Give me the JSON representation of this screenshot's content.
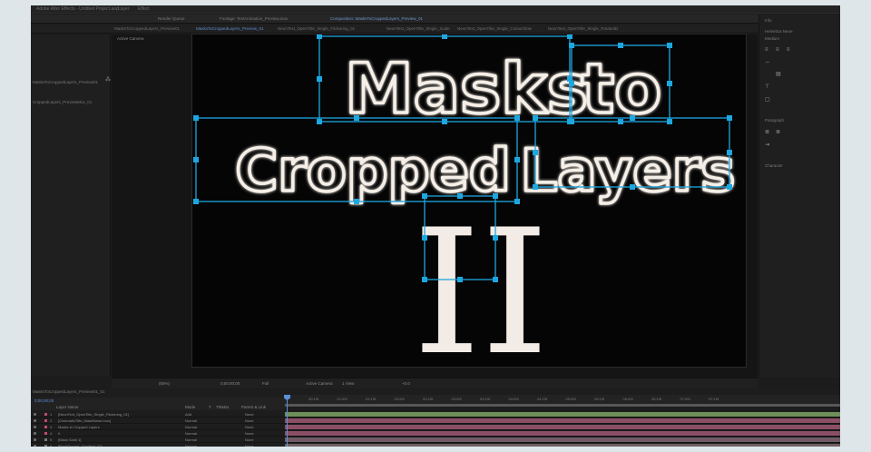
{
  "app": {
    "title": "Adobe After Effects - Untitled Project.aep",
    "menu_items": [
      "Layer",
      "Effect",
      "Animation",
      "View",
      "Window",
      "Help"
    ],
    "panel_tabs": [
      "Render Queue",
      "Footage: TextAnimation_Preview.mov",
      "Composition: MasksToCroppedLayers_Preview_01"
    ]
  },
  "comp_tabs": [
    {
      "label": "MasksToCroppedLayers_Preview01",
      "selected": false
    },
    {
      "label": "MasksToCroppedLayers_Preview_01",
      "selected": true
    },
    {
      "label": "NeonText_OpenTitle_Single_Flickering_01",
      "selected": false
    },
    {
      "label": "NeonText_OpenTitle_Single_Scale",
      "selected": false
    },
    {
      "label": "NeonText_OpenTitle_Single_ColourGlow",
      "selected": false
    },
    {
      "label": "NeonText_OpenTitle_Single_Rotate3D",
      "selected": false
    }
  ],
  "project_panel": {
    "items": [
      "MasksToCroppedLayers_Preview01",
      "CroppedLayers_PreviewMov_01"
    ]
  },
  "viewer": {
    "caption": "Active Camera",
    "lines": [
      "Masks to",
      "Cropped Layers",
      "II"
    ],
    "accent_color": "#1da7e0",
    "text_color": "#f5efe8",
    "numeral_color": "#f3ece6"
  },
  "viewer_bar": {
    "zoom": "(50%)",
    "time": "0;00;00;00",
    "resolution": "Full",
    "camera": "Active Camera",
    "view": "1 View",
    "exposure": "+0.0"
  },
  "right_panel": {
    "title": "Info",
    "sections": [
      "Align",
      "Paragraph",
      "Character"
    ],
    "font_label": "Helvetica Neue",
    "font_style": "Medium"
  },
  "timeline": {
    "tab": "MasksToCroppedLayers_Preview01_01",
    "timecode": "0;00;00;00",
    "columns": [
      "Layer Name",
      "Mode",
      "T",
      "TrkMat",
      "Parent & Link"
    ],
    "ruler_ticks": [
      "00:15f",
      "01:00f",
      "01:15f",
      "02:00f",
      "02:15f",
      "03:00f",
      "03:15f",
      "04:00f",
      "04:15f",
      "05:00f",
      "05:15f",
      "06:00f",
      "06:15f",
      "07:00f",
      "07:15f"
    ],
    "layers": [
      {
        "num": "1",
        "name": "[NeonText_OpenTitle_Single_Flickering_01]",
        "mode": "Add",
        "parent": "None",
        "color": "#c4496c",
        "bar_color": "#6e8e5a"
      },
      {
        "num": "2",
        "name": "[CinematicTitle_MaskNoise.mov]",
        "mode": "Normal",
        "parent": "None",
        "color": "#c4496c",
        "bar_color": "#8a4f66"
      },
      {
        "num": "3",
        "name": "Masks to Cropped Layers",
        "mode": "Normal",
        "parent": "None",
        "color": "#c4496c",
        "bar_color": "#8a4f66"
      },
      {
        "num": "4",
        "name": "II",
        "mode": "Normal",
        "parent": "None",
        "color": "#c4496c",
        "bar_color": "#8a4f66"
      },
      {
        "num": "5",
        "name": "[Black Solid 1]",
        "mode": "Normal",
        "parent": "None",
        "color": "#777777",
        "bar_color": "#6f5a66"
      },
      {
        "num": "6",
        "name": "[BackGround_Gradient_01]",
        "mode": "Normal",
        "parent": "None",
        "color": "#777777",
        "bar_color": "#6e5f63"
      }
    ]
  }
}
